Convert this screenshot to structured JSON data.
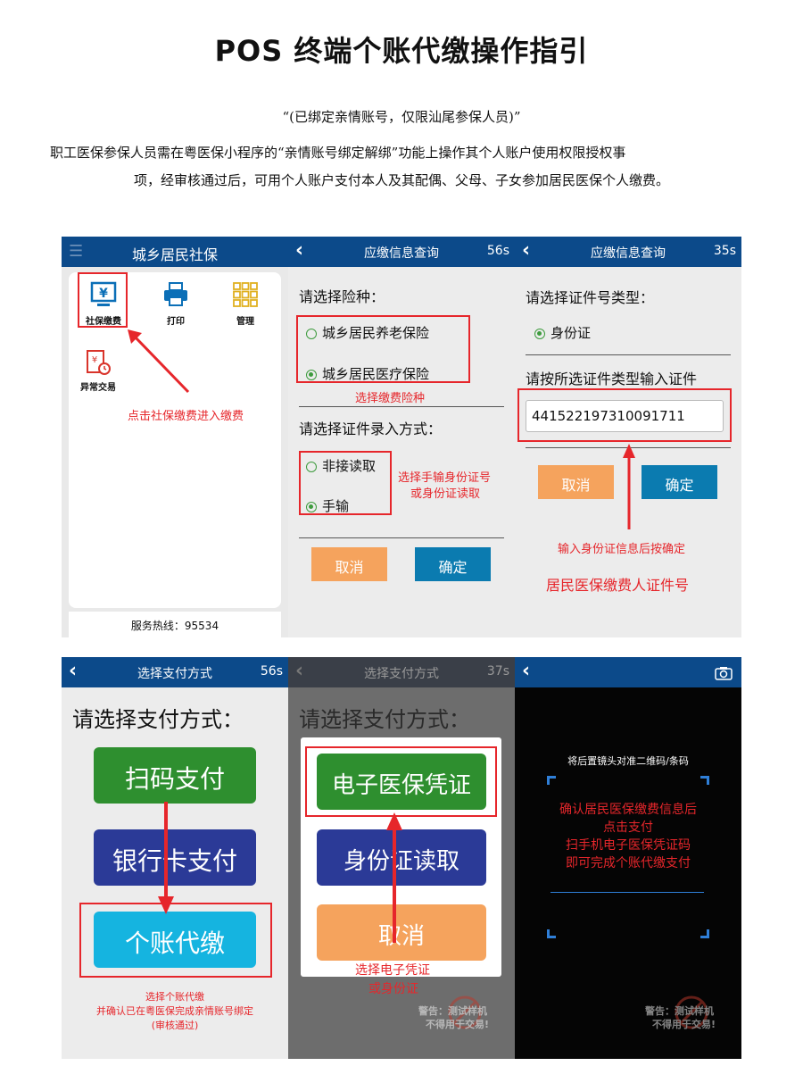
{
  "doc": {
    "title": "POS 终端个账代缴操作指引",
    "subtitle": "“(已绑定亲情账号，仅限汕尾参保人员)”",
    "para1": "职工医保参保人员需在粤医保小程序的“亲情账号绑定解绑”功能上操作其个人账户使用权限授权事",
    "para2": "项，经审核通过后，可用个人账户支付本人及其配偶、父母、子女参加居民医保个人缴费。"
  },
  "screen1": {
    "title": "城乡居民社保",
    "icons": [
      "社保缴费",
      "打印",
      "管理",
      "异常交易"
    ],
    "hint": "点击社保缴费进入缴费",
    "hotline": "服务热线：95534"
  },
  "screen2": {
    "title": "应缴信息查询",
    "countdown": "56s",
    "q1": "请选择险种：",
    "opt1": "城乡居民养老保险",
    "opt2": "城乡居民医疗保险",
    "hint1": "选择缴费险种",
    "q2": "请选择证件录入方式：",
    "opt3": "非接读取",
    "opt4": "手输",
    "hint2a": "选择手输身份证号",
    "hint2b": "或身份证读取",
    "cancel": "取消",
    "confirm": "确定"
  },
  "screen3": {
    "title": "应缴信息查询",
    "countdown": "35s",
    "q1": "请选择证件号类型：",
    "opt1": "身份证",
    "q2": "请按所选证件类型输入证件",
    "idnum": "441522197310091711",
    "cancel": "取消",
    "confirm": "确定",
    "hint1": "输入身份证信息后按确定",
    "hint2": "居民医保缴费人证件号"
  },
  "screen4": {
    "title": "选择支付方式",
    "countdown": "56s",
    "q": "请选择支付方式：",
    "btn1": "扫码支付",
    "btn2": "银行卡支付",
    "btn3": "个账代缴",
    "hint1": "选择个账代缴",
    "hint2": "并确认已在粤医保完成亲情账号绑定",
    "hint3": "(审核通过)"
  },
  "screen5": {
    "title": "选择支付方式",
    "countdown": "37s",
    "q": "请选择支付方式：",
    "btn1": "电子医保凭证",
    "btn2": "身份证读取",
    "btn3": "取消",
    "hint1": "选择电子凭证",
    "hint2": "或身份证",
    "watermark1": "警告：测试样机",
    "watermark2": "不得用于交易!"
  },
  "screen6": {
    "scan_tip": "将后置镜头对准二维码/条码",
    "hint1": "确认居民医保缴费信息后",
    "hint2": "点击支付",
    "hint3": "扫手机电子医保凭证码",
    "hint4": "即可完成个账代缴支付",
    "watermark1": "警告：测试样机",
    "watermark2": "不得用于交易!"
  },
  "colors": {
    "bar": "#0c4a8a",
    "red": "#e6262b",
    "green": "#2e8f2f",
    "blue": "#2b3a97",
    "cyan": "#15b4e0",
    "orange": "#f5a35d",
    "teal": "#0b7bb0"
  }
}
